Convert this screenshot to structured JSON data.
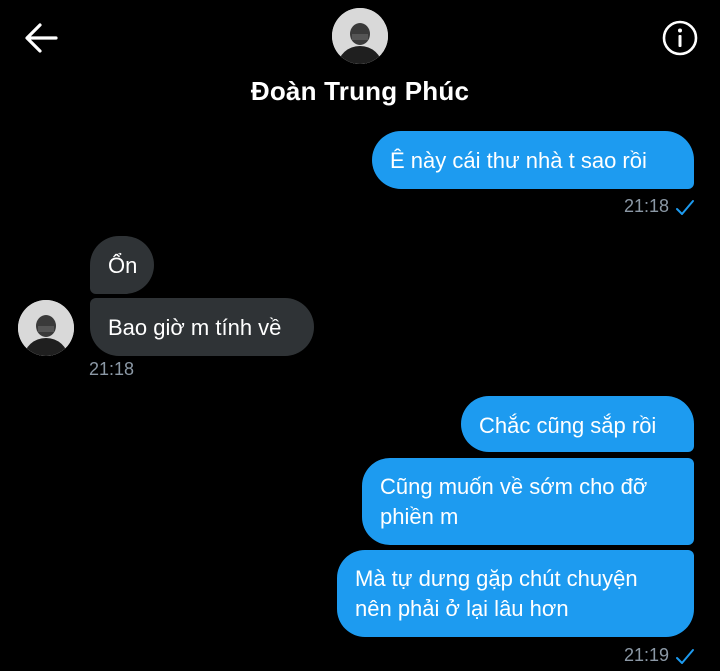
{
  "header": {
    "contact_name": "Đoàn Trung Phúc",
    "back_icon": "arrow-left-icon",
    "info_icon": "info-circle-icon"
  },
  "messages": [
    {
      "direction": "outgoing",
      "text": "Ê này cái thư nhà t sao rồi"
    },
    {
      "direction": "incoming",
      "text": "Ổn"
    },
    {
      "direction": "incoming",
      "text": "Bao giờ m tính về"
    },
    {
      "direction": "outgoing",
      "text": "Chắc cũng sắp rồi"
    },
    {
      "direction": "outgoing",
      "text": "Cũng muốn về sớm cho đỡ phiền m"
    },
    {
      "direction": "outgoing",
      "text": "Mà tự dưng gặp chút chuyện nên phải ở lại lâu hơn"
    }
  ],
  "timestamps": {
    "group1": "21:18",
    "group2": "21:18",
    "group3": "21:19"
  },
  "colors": {
    "background": "#000000",
    "outgoing_bubble": "#1d9bf0",
    "incoming_bubble": "#2f3336",
    "timestamp": "#8b98a5",
    "read_check": "#1d9bf0"
  }
}
